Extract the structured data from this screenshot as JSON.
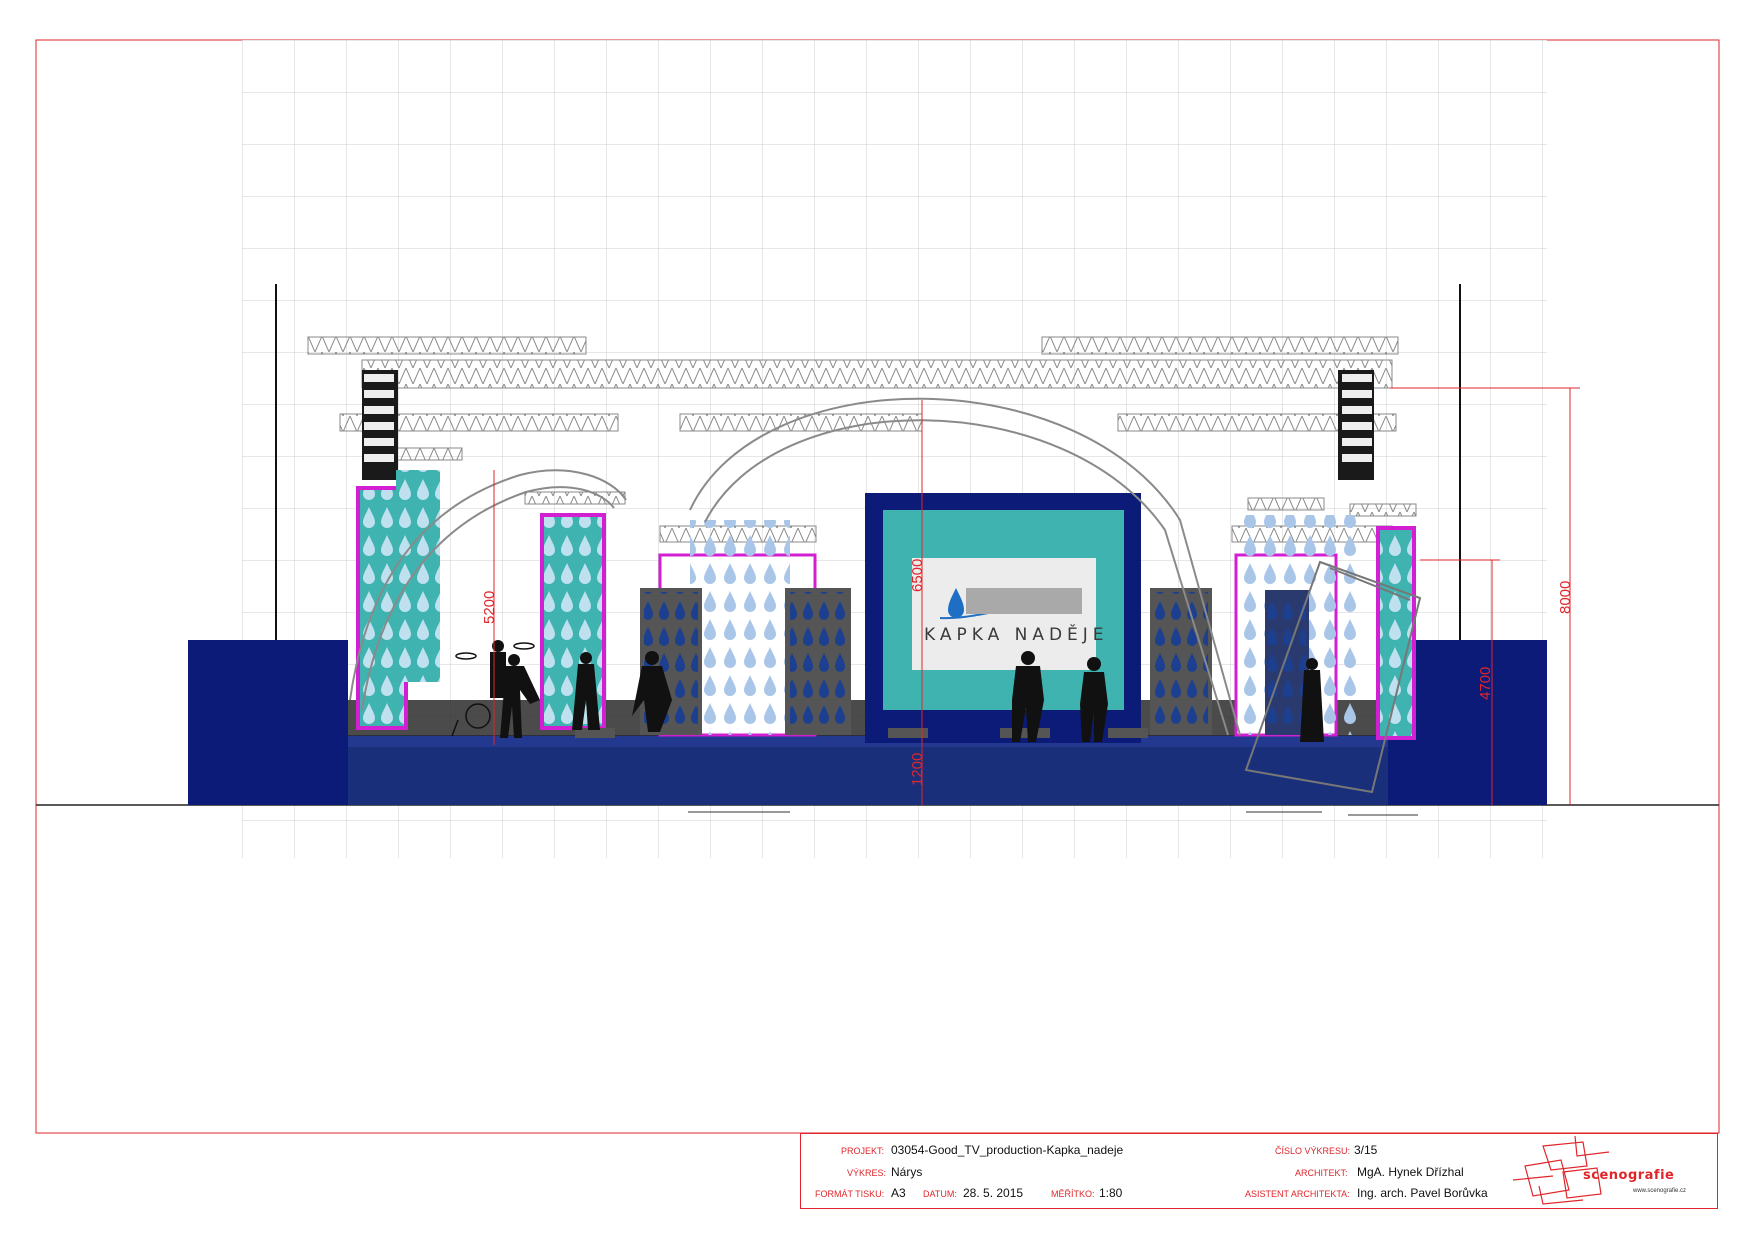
{
  "screen_logo": {
    "title": "KAPKA NADĚJE"
  },
  "dimensions": {
    "truss_height": "6500",
    "left_arch_height": "5200",
    "stage_height": "1200",
    "total_height": "8000",
    "right_tower_height": "4700"
  },
  "title_block": {
    "projekt_label": "PROJEKT:",
    "projekt_value": "03054-Good_TV_production-Kapka_nadeje",
    "vykres_label": "VÝKRES:",
    "vykres_value": "Nárys",
    "format_label": "FORMÁT TISKU:",
    "format_value": "A3",
    "datum_label": "DATUM:",
    "datum_value": "28. 5. 2015",
    "meritko_label": "MĚŘÍTKO:",
    "meritko_value": "1:80",
    "cislo_label": "ČÍSLO VÝKRESU:",
    "cislo_value": "3/15",
    "architekt_label": "ARCHITEKT:",
    "architekt_value": "MgA. Hynek Dřízhal",
    "asistent_label": "ASISTENT ARCHITEKTA:",
    "asistent_value": "Ing. arch. Pavel Borůvka",
    "brand_name": "scenografie",
    "brand_web": "www.scenografie.cz"
  },
  "colors": {
    "frame": "#e0262b",
    "stage": "#1a2f7a",
    "navy": "#0c1a78",
    "teal": "#3fb3b0",
    "magenta": "#d21fd2",
    "truss": "#9a9a9a"
  }
}
